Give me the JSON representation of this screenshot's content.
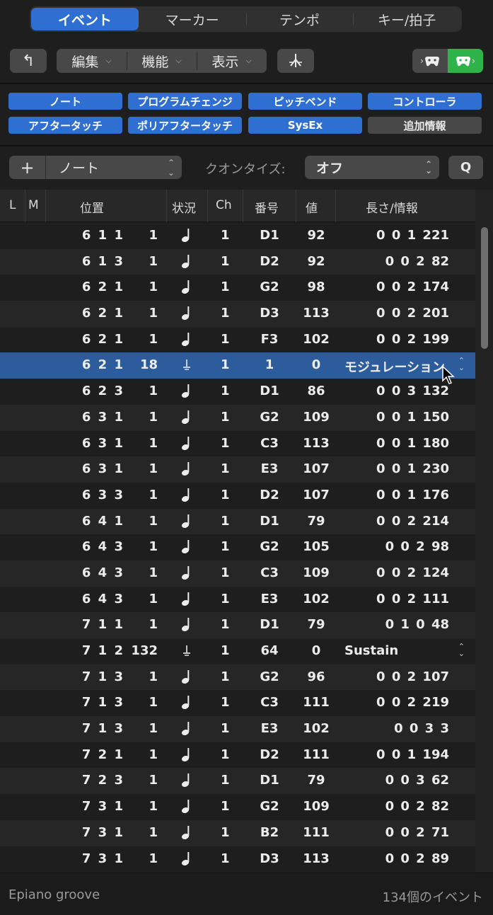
{
  "tabs": [
    {
      "label": "イベント",
      "active": true
    },
    {
      "label": "マーカー",
      "active": false
    },
    {
      "label": "テンポ",
      "active": false
    },
    {
      "label": "キー/拍子",
      "active": false
    }
  ],
  "toolbar": {
    "up_icon": "↰",
    "menus": [
      {
        "label": "編集"
      },
      {
        "label": "機能"
      },
      {
        "label": "表示"
      }
    ]
  },
  "filters": {
    "row1": [
      {
        "label": "ノート",
        "on": true
      },
      {
        "label": "プログラムチェンジ",
        "on": true
      },
      {
        "label": "ピッチベンド",
        "on": true
      },
      {
        "label": "コントローラ",
        "on": true
      }
    ],
    "row2": [
      {
        "label": "アフタータッチ",
        "on": true
      },
      {
        "label": "ポリアフタータッチ",
        "on": true
      },
      {
        "label": "SysEx",
        "on": true
      },
      {
        "label": "追加情報",
        "on": false
      }
    ]
  },
  "create": {
    "plus": "+",
    "type_value": "ノート",
    "quantize_label": "クオンタイズ:",
    "quantize_value": "オフ",
    "q_button": "Q"
  },
  "columns": {
    "l": "L",
    "m": "M",
    "position": "位置",
    "status": "状況",
    "ch": "Ch",
    "num": "番号",
    "val": "値",
    "length": "長さ/情報"
  },
  "events": [
    {
      "pos": "6 1 1",
      "tick": "1",
      "status": "note",
      "ch": "1",
      "num": "D1",
      "val": "92",
      "len": "0 0 1 221"
    },
    {
      "pos": "6 1 3",
      "tick": "1",
      "status": "note",
      "ch": "1",
      "num": "D2",
      "val": "92",
      "len": "0 0 2 82"
    },
    {
      "pos": "6 2 1",
      "tick": "1",
      "status": "note",
      "ch": "1",
      "num": "G2",
      "val": "98",
      "len": "0 0 2 174"
    },
    {
      "pos": "6 2 1",
      "tick": "1",
      "status": "note",
      "ch": "1",
      "num": "D3",
      "val": "113",
      "len": "0 0 2 201"
    },
    {
      "pos": "6 2 1",
      "tick": "1",
      "status": "note",
      "ch": "1",
      "num": "F3",
      "val": "102",
      "len": "0 0 2 199"
    },
    {
      "pos": "6 2 1",
      "tick": "18",
      "status": "ctrl",
      "ch": "1",
      "num": "1",
      "val": "0",
      "len": "モジュレーション",
      "selected": true,
      "popup": true
    },
    {
      "pos": "6 2 3",
      "tick": "1",
      "status": "note",
      "ch": "1",
      "num": "D1",
      "val": "86",
      "len": "0 0 3 132"
    },
    {
      "pos": "6 3 1",
      "tick": "1",
      "status": "note",
      "ch": "1",
      "num": "G2",
      "val": "109",
      "len": "0 0 1 150"
    },
    {
      "pos": "6 3 1",
      "tick": "1",
      "status": "note",
      "ch": "1",
      "num": "C3",
      "val": "113",
      "len": "0 0 1 180"
    },
    {
      "pos": "6 3 1",
      "tick": "1",
      "status": "note",
      "ch": "1",
      "num": "E3",
      "val": "107",
      "len": "0 0 1 230"
    },
    {
      "pos": "6 3 3",
      "tick": "1",
      "status": "note",
      "ch": "1",
      "num": "D2",
      "val": "107",
      "len": "0 0 1 176"
    },
    {
      "pos": "6 4 1",
      "tick": "1",
      "status": "note",
      "ch": "1",
      "num": "D1",
      "val": "79",
      "len": "0 0 2 214"
    },
    {
      "pos": "6 4 3",
      "tick": "1",
      "status": "note",
      "ch": "1",
      "num": "G2",
      "val": "105",
      "len": "0 0 2 98"
    },
    {
      "pos": "6 4 3",
      "tick": "1",
      "status": "note",
      "ch": "1",
      "num": "C3",
      "val": "109",
      "len": "0 0 2 124"
    },
    {
      "pos": "6 4 3",
      "tick": "1",
      "status": "note",
      "ch": "1",
      "num": "E3",
      "val": "102",
      "len": "0 0 2 111"
    },
    {
      "pos": "7 1 1",
      "tick": "1",
      "status": "note",
      "ch": "1",
      "num": "D1",
      "val": "79",
      "len": "0 1 0 48"
    },
    {
      "pos": "7 1 2",
      "tick": "132",
      "status": "ctrl",
      "ch": "1",
      "num": "64",
      "val": "0",
      "len": "Sustain",
      "popup": true
    },
    {
      "pos": "7 1 3",
      "tick": "1",
      "status": "note",
      "ch": "1",
      "num": "G2",
      "val": "96",
      "len": "0 0 2 107"
    },
    {
      "pos": "7 1 3",
      "tick": "1",
      "status": "note",
      "ch": "1",
      "num": "C3",
      "val": "111",
      "len": "0 0 2 219"
    },
    {
      "pos": "7 1 3",
      "tick": "1",
      "status": "note",
      "ch": "1",
      "num": "E3",
      "val": "102",
      "len": "0 0 3 3"
    },
    {
      "pos": "7 2 1",
      "tick": "1",
      "status": "note",
      "ch": "1",
      "num": "D2",
      "val": "111",
      "len": "0 0 1 194"
    },
    {
      "pos": "7 2 3",
      "tick": "1",
      "status": "note",
      "ch": "1",
      "num": "D1",
      "val": "79",
      "len": "0 0 3 62"
    },
    {
      "pos": "7 3 1",
      "tick": "1",
      "status": "note",
      "ch": "1",
      "num": "G2",
      "val": "109",
      "len": "0 0 2 82"
    },
    {
      "pos": "7 3 1",
      "tick": "1",
      "status": "note",
      "ch": "1",
      "num": "B2",
      "val": "111",
      "len": "0 0 2 71"
    },
    {
      "pos": "7 3 1",
      "tick": "1",
      "status": "note",
      "ch": "1",
      "num": "D3",
      "val": "113",
      "len": "0 0 2 89"
    }
  ],
  "footer": {
    "region": "Epiano groove",
    "count": "134個のイベント"
  },
  "colors": {
    "accent": "#2f6fd1",
    "selection": "#2c5c9c",
    "midi_green": "#2eb24a"
  }
}
